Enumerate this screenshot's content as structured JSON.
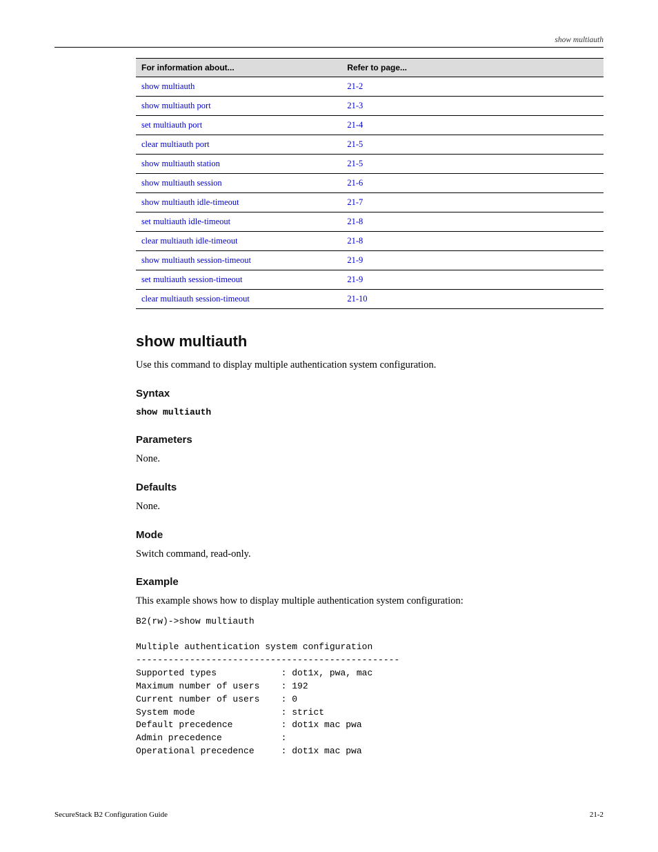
{
  "header": {
    "running_title": "show multiauth"
  },
  "table": {
    "headers": [
      "For information about...",
      "Refer to page..."
    ],
    "rows": [
      {
        "cmd": "show multiauth",
        "cmd_href": "#",
        "page": "21-2",
        "page_href": "#"
      },
      {
        "cmd": "show multiauth port",
        "cmd_href": "#",
        "page": "21-3",
        "page_href": "#"
      },
      {
        "cmd": "set multiauth port",
        "cmd_href": "#",
        "page": "21-4",
        "page_href": "#"
      },
      {
        "cmd": "clear multiauth port",
        "cmd_href": "#",
        "page": "21-5",
        "page_href": "#"
      },
      {
        "cmd": "show multiauth station",
        "cmd_href": "#",
        "page": "21-5",
        "page_href": "#"
      },
      {
        "cmd": "show multiauth session",
        "cmd_href": "#",
        "page": "21-6",
        "page_href": "#"
      },
      {
        "cmd": "show multiauth idle-timeout",
        "cmd_href": "#",
        "page": "21-7",
        "page_href": "#"
      },
      {
        "cmd": "set multiauth idle-timeout",
        "cmd_href": "#",
        "page": "21-8",
        "page_href": "#"
      },
      {
        "cmd": "clear multiauth idle-timeout",
        "cmd_href": "#",
        "page": "21-8",
        "page_href": "#"
      },
      {
        "cmd": "show multiauth session-timeout",
        "cmd_href": "#",
        "page": "21-9",
        "page_href": "#"
      },
      {
        "cmd": "set multiauth session-timeout",
        "cmd_href": "#",
        "page": "21-9",
        "page_href": "#"
      },
      {
        "cmd": "clear multiauth session-timeout",
        "cmd_href": "#",
        "page": "21-10",
        "page_href": "#"
      }
    ]
  },
  "command": {
    "title": "show multiauth",
    "description": "Use this command to display multiple authentication system configuration.",
    "syntax_heading": "Syntax",
    "syntax_text": "show multiauth",
    "parameters_heading": "Parameters",
    "parameters_text": "None.",
    "defaults_heading": "Defaults",
    "defaults_text": "None.",
    "mode_heading": "Mode",
    "mode_text": "Switch command, read-only.",
    "example_heading": "Example",
    "example_intro": "This example shows how to display multiple authentication system configuration:",
    "example_output": "B2(rw)->show multiauth\n\nMultiple authentication system configuration\n-------------------------------------------------\nSupported types            : dot1x, pwa, mac\nMaximum number of users    : 192\nCurrent number of users    : 0\nSystem mode                : strict\nDefault precedence         : dot1x mac pwa\nAdmin precedence           :\nOperational precedence     : dot1x mac pwa"
  },
  "footer": {
    "left": "SecureStack B2 Configuration Guide",
    "right": "21-2"
  }
}
